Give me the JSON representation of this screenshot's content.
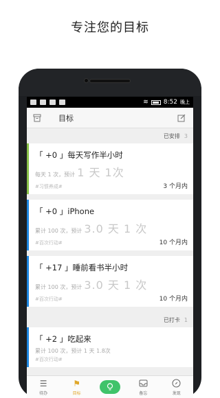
{
  "headline": "专注您的目标",
  "status_bar": {
    "time": "8:52",
    "ampm": "晚上"
  },
  "app_bar": {
    "title": "目标"
  },
  "sections": [
    {
      "label": "已安排",
      "count": "3",
      "cards": [
        {
          "title": "「 +0 」每天写作半小时",
          "meta_prefix": "每天 1 次，预计",
          "meta_big": "1 天 1次",
          "tag": "#习惯养成#",
          "duration": "3 个月内",
          "color": "#8bc34a"
        },
        {
          "title": "「 +0 」iPhone",
          "meta_prefix": "累计 100 次，预计",
          "meta_big": "3.0 天 1 次",
          "tag": "#百次行动#",
          "duration": "10 个月内",
          "color": "#1e88e5"
        },
        {
          "title": "「 +17 」睡前看书半小时",
          "meta_prefix": "累计 100 次，预计",
          "meta_big": "3.0 天 1 次",
          "tag": "#百次行动#",
          "duration": "10 个月内",
          "color": "#1e88e5"
        }
      ]
    },
    {
      "label": "已打卡",
      "count": "1",
      "cards": [
        {
          "title": "「 +2 」吃起来",
          "meta_prefix": "累计 100 次，预计 1 天 1.8次",
          "meta_big": "",
          "tag": "#百次行动#",
          "duration": "",
          "color": "#1e88e5"
        }
      ]
    }
  ],
  "tabs": [
    {
      "label": "待办",
      "icon": "list-icon"
    },
    {
      "label": "目标",
      "icon": "flag-icon",
      "active": true
    },
    {
      "label": "",
      "icon": "bulb-icon"
    },
    {
      "label": "备忘",
      "icon": "inbox-icon"
    },
    {
      "label": "发现",
      "icon": "compass-icon"
    }
  ]
}
